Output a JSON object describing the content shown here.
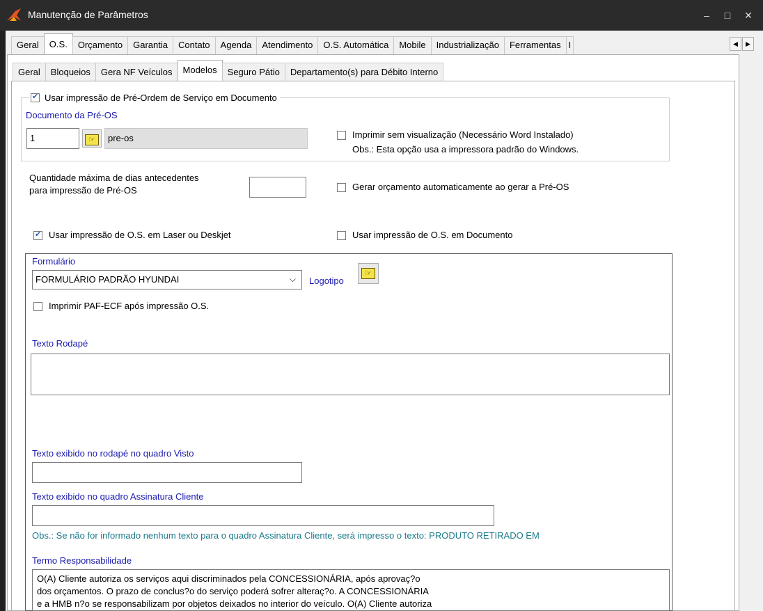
{
  "window": {
    "title": "Manutenção de Parâmetros",
    "minimize": "‒",
    "maximize": "□",
    "close": "✕"
  },
  "main_tabs": [
    "Geral",
    "O.S.",
    "Orçamento",
    "Garantia",
    "Contato",
    "Agenda",
    "Atendimento",
    "O.S. Automática",
    "Mobile",
    "Industrialização",
    "Ferramentas",
    "I"
  ],
  "main_tab_active": "O.S.",
  "sub_tabs": [
    "Geral",
    "Bloqueios",
    "Gera NF Veículos",
    "Modelos",
    "Seguro Pátio",
    "Departamento(s) para Débito Interno"
  ],
  "sub_tab_active": "Modelos",
  "preos": {
    "use_label": "Usar impressão de Pré-Ordem de Serviço em Documento",
    "use_checked": true,
    "doc_label": "Documento da Pré-OS",
    "doc_code": "1",
    "doc_name": "pre-os",
    "print_no_preview_label": "Imprimir sem visualização (Necessário Word Instalado)",
    "print_no_preview_checked": false,
    "note": "Obs.: Esta opção usa a impressora padrão do Windows."
  },
  "max_days": {
    "label_line1": "Quantidade máxima de dias antecedentes",
    "label_line2": "para impressão de Pré-OS",
    "value": ""
  },
  "gen_budget": {
    "label": "Gerar orçamento automaticamente ao gerar a Pré-OS",
    "checked": false
  },
  "laser": {
    "label": "Usar impressão de O.S. em Laser ou Deskjet",
    "checked": true
  },
  "os_doc": {
    "label": "Usar impressão de O.S. em Documento",
    "checked": false
  },
  "form": {
    "label": "Formulário",
    "selected": "FORMULÁRIO PADRÃO HYUNDAI",
    "logo_label": "Logotipo"
  },
  "paf": {
    "label": "Imprimir PAF-ECF após impressão O.S.",
    "checked": false
  },
  "footer_text": {
    "label": "Texto Rodapé",
    "value": ""
  },
  "visto": {
    "label": "Texto exibido no rodapé no quadro Visto",
    "value": ""
  },
  "assinatura": {
    "label": "Texto exibido no quadro Assinatura Cliente",
    "value": "",
    "note": "Obs.: Se não for informado nenhum texto para o quadro Assinatura Cliente, será impresso o texto: PRODUTO RETIRADO EM"
  },
  "termo": {
    "label": "Termo Responsabilidade",
    "lines": [
      "O(A) Cliente autoriza os serviços aqui discriminados pela CONCESSIONÁRIA, após aprovaç?o",
      "dos orçamentos. O prazo de conclus?o do serviço poderá sofrer alteraç?o. A CONCESSIONÁRIA",
      "e a HMB n?o se responsabilizam por objetos deixados no interior do veículo. O(A) Cliente autoriza"
    ]
  },
  "colors": {
    "accent_text": "#1a1ab0",
    "note_text": "#1a7a8a",
    "titlebar": "#2b2b2b"
  }
}
